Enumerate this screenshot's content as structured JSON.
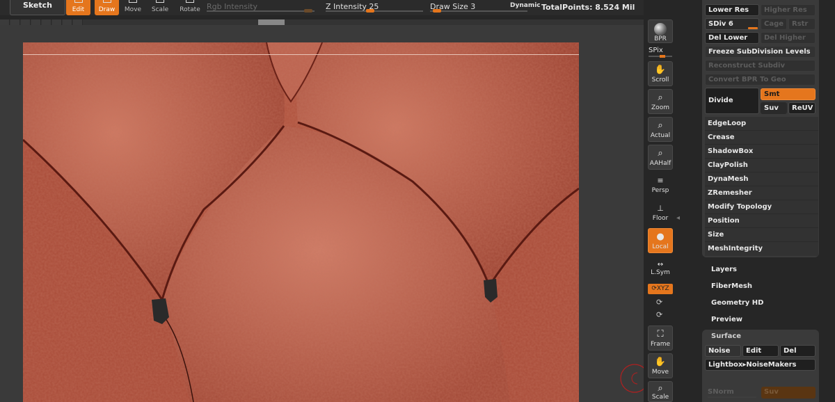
{
  "toolbar": {
    "sketch": "Sketch",
    "edit": "Edit",
    "draw": "Draw",
    "move": "Move",
    "scale": "Scale",
    "rotate": "Rotate",
    "rgb_intensity": "Rgb Intensity",
    "z_intensity": "Z Intensity 25",
    "draw_size": "Draw Size 3",
    "dynamic": "Dynamic",
    "total_points": "TotalPoints: 8.524 Mil"
  },
  "shelf": {
    "bpr": "BPR",
    "spix": "SPix",
    "scroll": "Scroll",
    "zoom": "Zoom",
    "actual": "Actual",
    "aahalf": "AAHalf",
    "persp": "Persp",
    "floor": "Floor",
    "local": "Local",
    "lsym": "L.Sym",
    "xyz": "⟳XYZ",
    "frame": "Frame",
    "move": "Move",
    "scale": "Scale"
  },
  "geometry": {
    "lower_res": "Lower Res",
    "higher_res": "Higher Res",
    "sdiv": "SDiv 6",
    "cage": "Cage",
    "rstr": "Rstr",
    "del_lower": "Del Lower",
    "del_higher": "Del Higher",
    "freeze": "Freeze SubDivision Levels",
    "reconstruct": "Reconstruct Subdiv",
    "convert_bpr": "Convert BPR To Geo",
    "divide": "Divide",
    "smt": "Smt",
    "suv": "Suv",
    "reuv": "ReUV",
    "rows": [
      "EdgeLoop",
      "Crease",
      "ShadowBox",
      "ClayPolish",
      "DynaMesh",
      "ZRemesher",
      "Modify Topology",
      "Position",
      "Size",
      "MeshIntegrity"
    ]
  },
  "sections": [
    "Layers",
    "FiberMesh",
    "Geometry HD",
    "Preview"
  ],
  "surface": {
    "title": "Surface",
    "noise": "Noise",
    "edit": "Edit",
    "del": "Del",
    "lightbox": "Lightbox▸NoiseMakers",
    "snorm": "SNorm",
    "suv": "Suv"
  },
  "colors": {
    "accent": "#e5761d",
    "skin": "#b55944"
  }
}
